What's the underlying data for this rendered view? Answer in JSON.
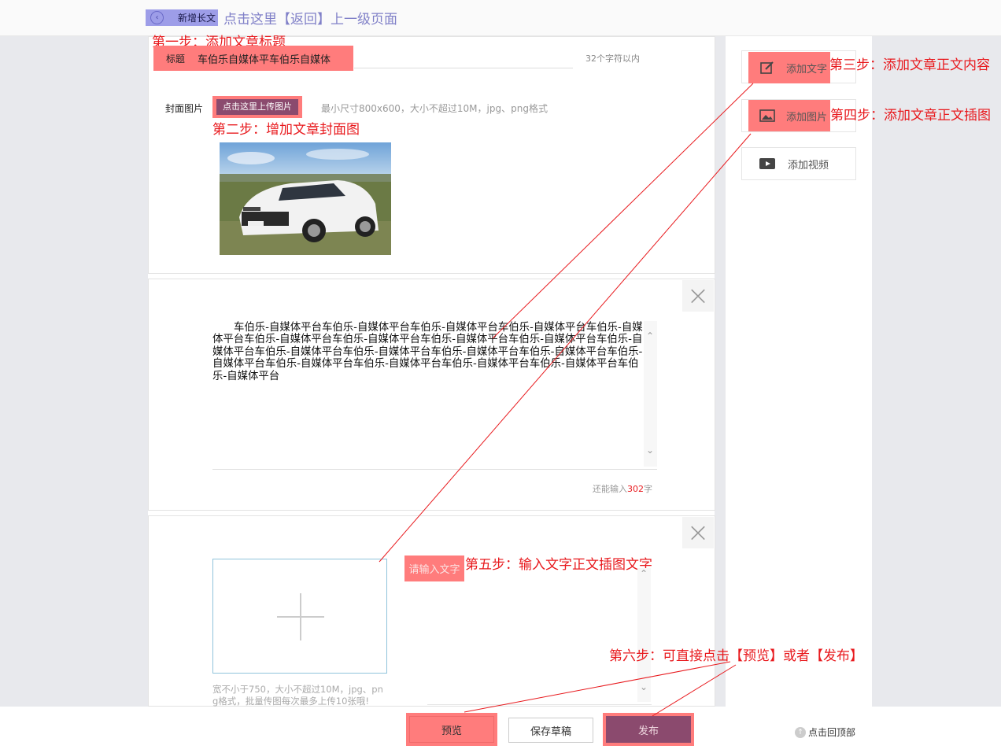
{
  "header": {
    "back_label": "新增长文",
    "back_hint": "点击这里【返回】上一级页面"
  },
  "annotations": {
    "step1": "第一步：添加文章标题",
    "step2": "第二步：增加文章封面图",
    "step3": "第三步：添加文章正文内容",
    "step4": "第四步：添加文章正文插图",
    "step5": "第五步：输入文字正文插图文字",
    "step6": "第六步：可直接点击【预览】或者【发布】"
  },
  "title_section": {
    "label": "标题",
    "value": "车伯乐自媒体平车伯乐自媒体",
    "limit": "32个字符以内"
  },
  "cover_section": {
    "label": "封面图片",
    "upload_button": "点击这里上传图片",
    "hint": "最小尺寸800x600，大小不超过10M，jpg、png格式"
  },
  "text_block": {
    "content": "车伯乐-自媒体平台车伯乐-自媒体平台车伯乐-自媒体平台车伯乐-自媒体平台车伯乐-自媒体平台车伯乐-自媒体平台车伯乐-自媒体平台车伯乐-自媒体平台车伯乐-自媒体平台车伯乐-自媒体平台车伯乐-自媒体平台车伯乐-自媒体平台车伯乐-自媒体平台车伯乐-自媒体平台车伯乐-自媒体平台车伯乐-自媒体平台车伯乐-自媒体平台车伯乐-自媒体平台车伯乐-自媒体平台车伯乐-自媒体平台",
    "remain_prefix": "还能输入",
    "remain_count": "302",
    "remain_suffix": "字",
    "close_icon": "×"
  },
  "image_block": {
    "hint": "宽不小于750，大小不超过10M，jpg、png格式，批量传图每次最多上传10张哦!",
    "caption_placeholder": "请输入文字",
    "close_icon": "×"
  },
  "sidebar": {
    "add_text": "添加文字",
    "add_image": "添加图片",
    "add_video": "添加视频"
  },
  "footer": {
    "preview": "预览",
    "save_draft": "保存草稿",
    "publish": "发布",
    "back_to_top": "点击回顶部"
  },
  "colors": {
    "annotation_red": "#e8191d",
    "highlight_pink": "#ff7c7c",
    "publish_purple": "#8b4a6e",
    "gutter_gray": "#e8e9ed"
  }
}
